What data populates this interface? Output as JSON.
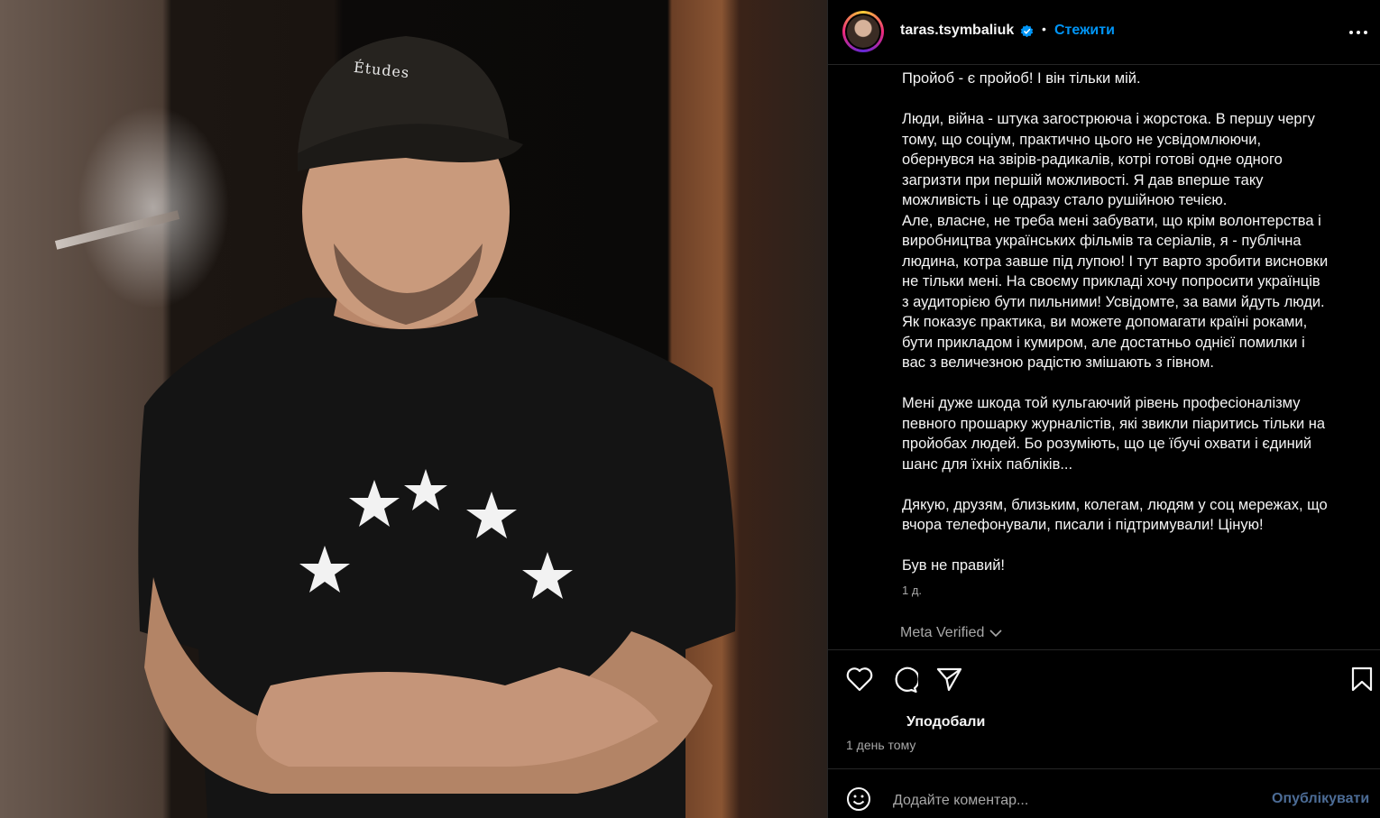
{
  "post": {
    "username": "taras.tsymbaliuk",
    "follow_label": "Стежити",
    "separator": "•",
    "caption": "Пройоб - є пройоб! І він тільки мій.\n\nЛюди, війна - штука загострююча і жорстока. В першу чергу\nтому, що соціум, практично цього не усвідомлюючи,\nобернувся на звірів-радикалів, котрі готові одне одного\nзагризти при першій можливості. Я дав вперше таку\nможливість і це одразу стало рушійною течією.\nАле, власне, не треба мені забувати, що крім волонтерства і\nвиробництва українських фільмів та серіалів, я - публічна\nлюдина, котра завше під лупою! І тут варто зробити висновки\nне тільки мені. На своєму прикладі хочу попросити українців\nз аудиторією бути пильними! Усвідомте, за вами йдуть люди.\nЯк показує практика, ви можете допомагати країні роками,\nбути прикладом і кумиром, але достатньо однієї помилки і\nвас з величезною радістю змішають з гівном.\n\nМені дуже шкода той кульгаючий рівень професіоналізму\nпевного прошарку журналістів, які звикли піаритись тільки на\nпройобах людей. Бо розуміють, що це їбучі охвати і єдиний\nшанс для їхніх пабліків...\n\nДякую, друзям, близьким, колегам, людям у соц мережах, що\nвчора телефонували, писали і підтримували! Ціную!\n\nБув не правий!",
    "caption_age": "1 д.",
    "meta_verified_label": "Meta Verified",
    "likes_label": "Уподобали",
    "timestamp": "1 день тому",
    "comment_placeholder": "Додайте коментар...",
    "post_button": "Опублікувати"
  },
  "photo": {
    "cap_text": "Études"
  },
  "icons": {
    "verified": "verified-badge-icon",
    "more": "more-options-icon",
    "like": "heart-icon",
    "comment": "comment-icon",
    "share": "share-icon",
    "save": "bookmark-icon",
    "emoji": "emoji-icon",
    "meta_chevron": "chevron-down-icon"
  },
  "colors": {
    "accent": "#0095f6",
    "verified": "#0095f6",
    "post_button": "#4c6c96",
    "background": "#000000",
    "secondary_text": "#a8a8a8"
  }
}
